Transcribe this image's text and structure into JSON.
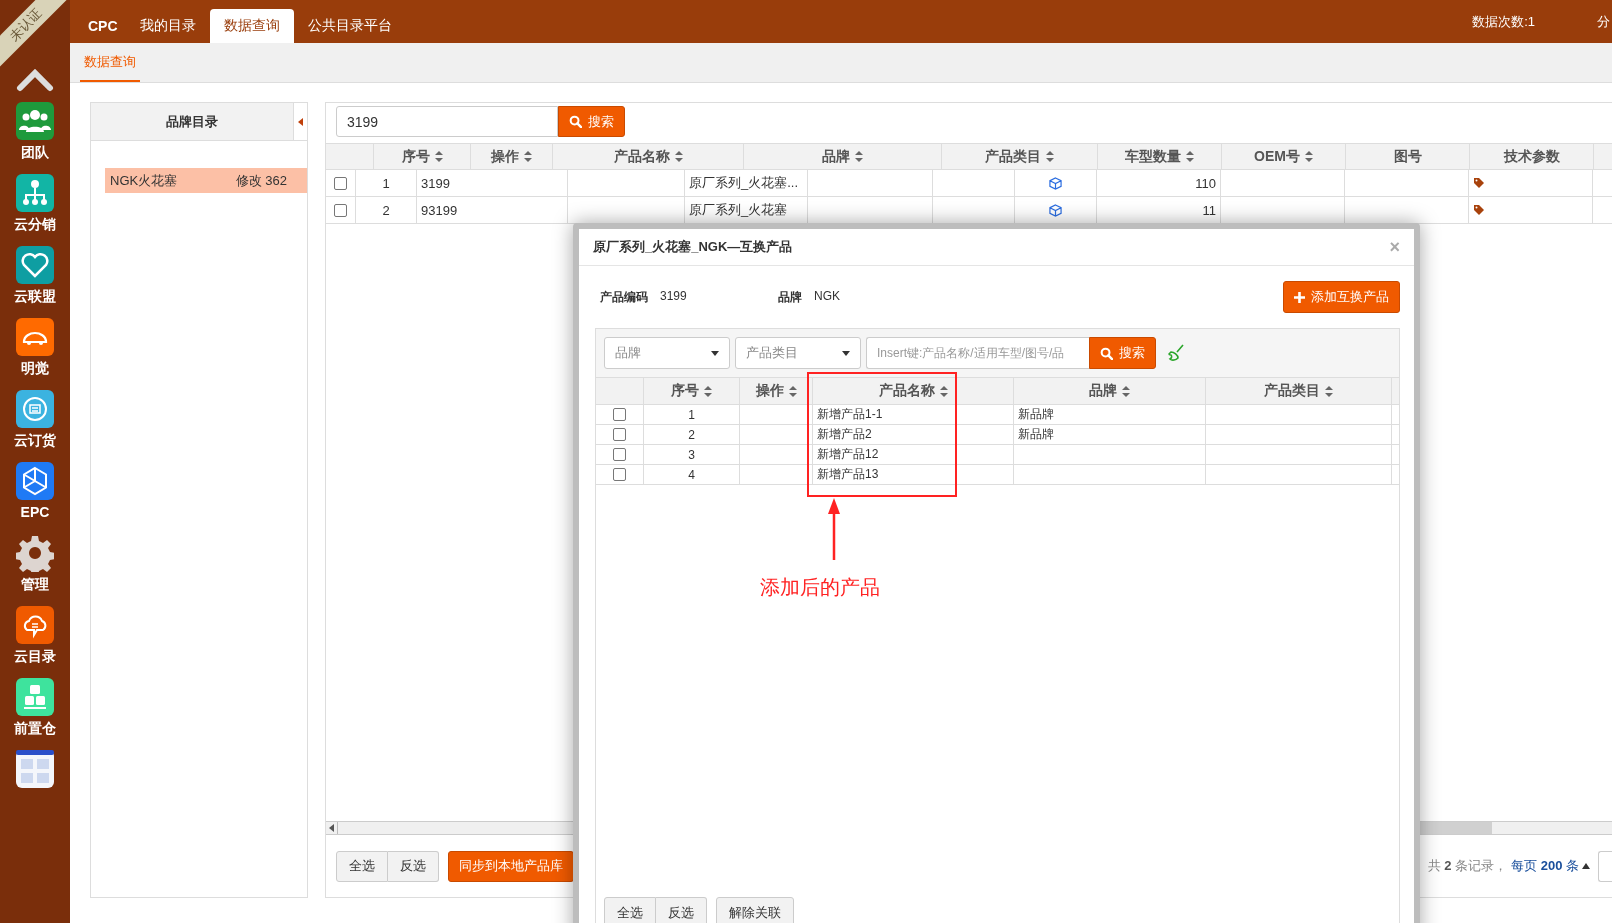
{
  "sidebar": {
    "badge": "未认证",
    "apps": [
      {
        "label": "团队",
        "kind": "team"
      },
      {
        "label": "云分销",
        "kind": "distribution"
      },
      {
        "label": "云联盟",
        "kind": "alliance"
      },
      {
        "label": "明觉",
        "kind": "cloudcar"
      },
      {
        "label": "云订货",
        "kind": "order"
      },
      {
        "label": "EPC",
        "kind": "epc"
      },
      {
        "label": "管理",
        "kind": "manage"
      },
      {
        "label": "云目录",
        "kind": "catalog"
      },
      {
        "label": "前置仓",
        "kind": "warehouse"
      },
      {
        "kind": "thumbnail"
      }
    ]
  },
  "top_nav": {
    "tabs": [
      {
        "label": "CPC",
        "selected": false
      },
      {
        "label": "我的目录",
        "selected": false
      },
      {
        "label": "数据查询",
        "selected": true
      },
      {
        "label": "公共目录平台",
        "selected": false
      }
    ],
    "usage": "数据次数:1",
    "cut_item": "分"
  },
  "sub_tabs": [
    {
      "label": "数据查询",
      "selected": true
    }
  ],
  "brand_panel": {
    "title": "品牌目录",
    "items": [
      {
        "name": "NGK火花塞",
        "action": "修改 362",
        "selected": true
      }
    ]
  },
  "search": {
    "value": "3199",
    "button": "搜索"
  },
  "table": {
    "columns": [
      {
        "label": "序号",
        "sortable": true
      },
      {
        "label": "操作",
        "sortable": true
      },
      {
        "label": "产品名称",
        "sortable": true
      },
      {
        "label": "品牌",
        "sortable": true
      },
      {
        "label": "产品类目",
        "sortable": true
      },
      {
        "label": "车型数量",
        "sortable": true
      },
      {
        "label": "OEM号",
        "sortable": true
      },
      {
        "label": "图号",
        "sortable": false
      },
      {
        "label": "技术参数",
        "sortable": false
      }
    ],
    "rows": [
      {
        "checked": false,
        "index": "1",
        "code": "3199",
        "name": "原厂系列_火花塞...",
        "vehicle_count": "110"
      },
      {
        "checked": false,
        "index": "2",
        "code": "93199",
        "name": "原厂系列_火花塞",
        "vehicle_count": "11"
      }
    ]
  },
  "footer": {
    "buttons": [
      "全选",
      "反选"
    ],
    "sync_button": "同步到本地产品库",
    "pager": "共 **2** 条记录，",
    "page_size": "每页 **200** 条"
  },
  "dialog": {
    "title": "原厂系列_火花塞_NGK—互换产品",
    "close": "×",
    "info": [
      {
        "label": "产品编码",
        "value": "3199"
      },
      {
        "label": "品牌",
        "value": "NGK"
      }
    ],
    "add_button": "添加互换产品",
    "filters": [
      {
        "placeholder": "品牌"
      },
      {
        "placeholder": "产品类目"
      }
    ],
    "search_placeholder": "Insert键:产品名称/适用车型/图号/品",
    "search_button": "搜索",
    "columns": [
      {
        "label": "序号",
        "sortable": true
      },
      {
        "label": "操作",
        "sortable": true
      },
      {
        "label": "产品名称",
        "sortable": true
      },
      {
        "label": "品牌",
        "sortable": true
      },
      {
        "label": "产品类目",
        "sortable": true
      }
    ],
    "rows": [
      {
        "checked": false,
        "index": "1",
        "name": "新增产品1-1",
        "brand": "新品牌"
      },
      {
        "checked": false,
        "index": "2",
        "name": "新增产品2",
        "brand": "新品牌"
      },
      {
        "checked": false,
        "index": "3",
        "name": "新增产品12"
      },
      {
        "checked": false,
        "index": "4",
        "name": "新增产品13"
      }
    ],
    "annotation": "添加后的产品",
    "buttons": [
      "全选",
      "反选"
    ],
    "unlink_button": "解除关联"
  }
}
